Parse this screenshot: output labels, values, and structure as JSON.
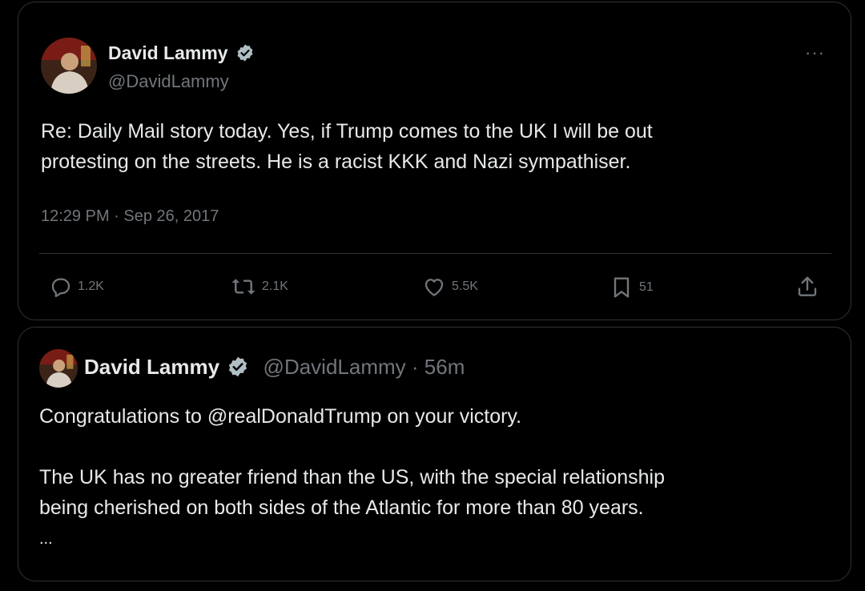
{
  "original_tweet": {
    "author": {
      "name": "David Lammy",
      "handle": "@DavidLammy",
      "verified": true,
      "avatar_icon": "profile-photo"
    },
    "more_label": "···",
    "text_lines": [
      "Re: Daily Mail story today. Yes, if Trump comes to the UK I will be out",
      "protesting on the streets. He is a racist KKK and Nazi sympathiser."
    ],
    "timestamp": "12:29 PM · Sep 26, 2017",
    "actions": {
      "replies": "1.2K",
      "reposts": "2.1K",
      "likes": "5.5K",
      "bookmarks": "51"
    }
  },
  "recent_tweet": {
    "author": {
      "name": "David Lammy",
      "handle": "@DavidLammy",
      "verified": true
    },
    "age": "· 56m",
    "text_line1": "Congratulations to @realDonaldTrump on your victory.",
    "text_lines_2": [
      "The UK has no greater friend than the US, with the special relationship",
      "being cherished on both sides of the Atlantic for more than 80 years."
    ],
    "ellipsis": "..."
  },
  "colors": {
    "background": "#000000",
    "text": "#e7e9ea",
    "muted": "#71767b",
    "border": "#2f3336",
    "verified_badge": "#b0bec5"
  }
}
